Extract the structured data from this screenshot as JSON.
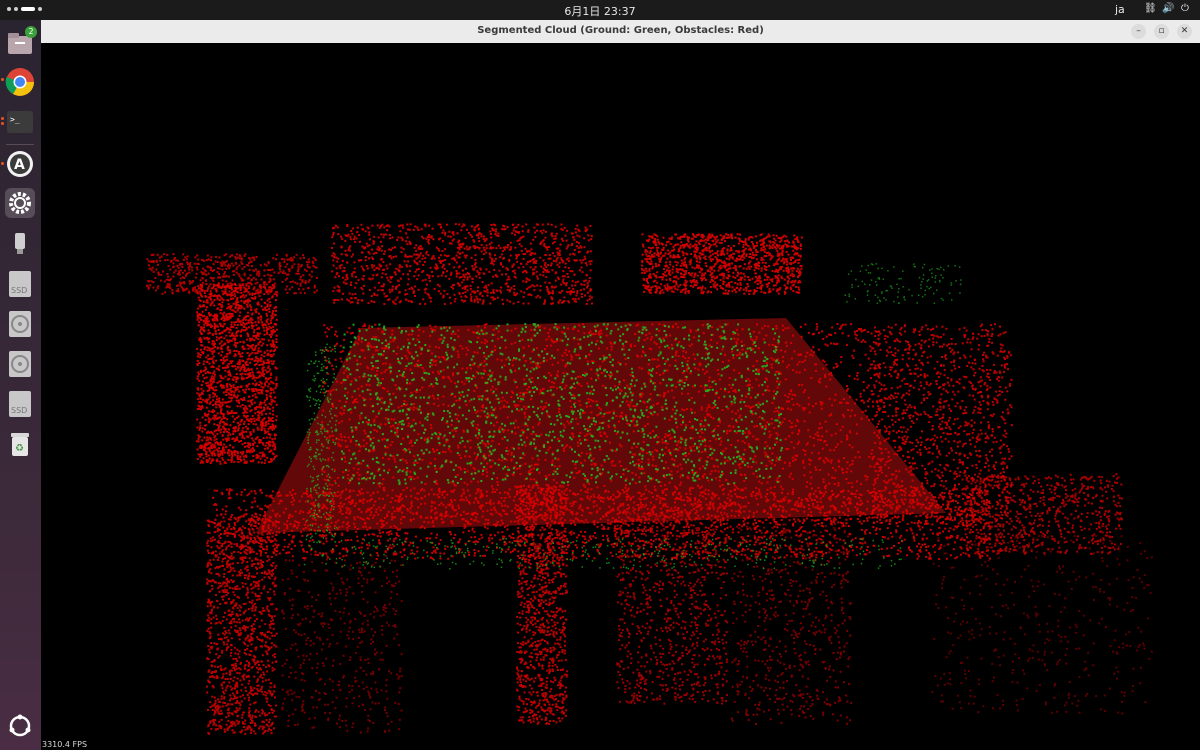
{
  "topbar": {
    "clock": "6月1日  23:37",
    "lang": "ja",
    "tray_icons": [
      "network-icon",
      "volume-icon",
      "power-icon"
    ]
  },
  "dock": {
    "items": [
      {
        "name": "files-icon",
        "badge": "2"
      },
      {
        "name": "chrome-icon"
      },
      {
        "name": "terminal-icon"
      },
      {
        "name": "software-center-icon"
      },
      {
        "name": "settings-icon"
      },
      {
        "name": "usb-drive-icon"
      },
      {
        "name": "ssd-drive-icon",
        "label": "SSD"
      },
      {
        "name": "disc-icon"
      },
      {
        "name": "disc-icon"
      },
      {
        "name": "ssd-drive-icon",
        "label": "SSD"
      },
      {
        "name": "trash-icon"
      },
      {
        "name": "show-apps-icon"
      }
    ]
  },
  "window": {
    "title": "Segmented Cloud (Ground: Green, Obstacles: Red)",
    "controls": [
      "minimize-icon",
      "maximize-icon",
      "close-icon"
    ],
    "fps": "3310.4 FPS"
  },
  "colors": {
    "ground": "#22c022",
    "obstacles": "#e00000",
    "background": "#000000"
  }
}
